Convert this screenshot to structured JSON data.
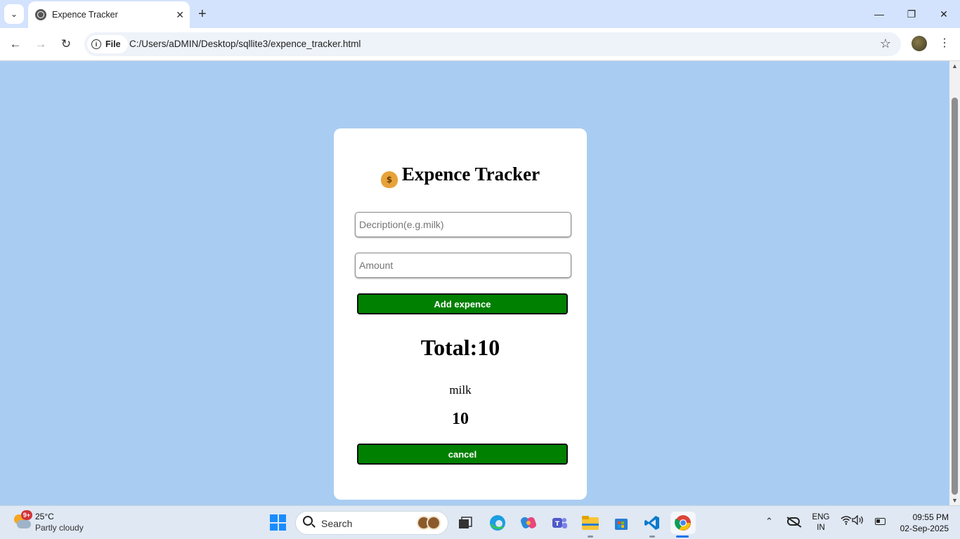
{
  "browser": {
    "tab_title": "Expence Tracker",
    "site_chip_label": "File",
    "url": "C:/Users/aDMIN/Desktop/sqllite3/expence_tracker.html"
  },
  "app": {
    "title_icon": "moneybag-icon",
    "title": "Expence Tracker",
    "description_placeholder": "Decription(e.g.milk)",
    "description_value": "",
    "amount_placeholder": "Amount",
    "amount_value": "",
    "add_button_label": "Add expence",
    "total_label": "Total:10",
    "expenses": [
      {
        "name": "milk",
        "amount": "10",
        "cancel_label": "cancel"
      }
    ],
    "colors": {
      "background": "#a9cdf2",
      "button": "#008000"
    }
  },
  "taskbar": {
    "weather_badge": "9+",
    "temperature": "25°C",
    "condition": "Partly cloudy",
    "search_label": "Search",
    "lang_line1": "ENG",
    "lang_line2": "IN",
    "time": "09:55 PM",
    "date": "02-Sep-2025"
  }
}
